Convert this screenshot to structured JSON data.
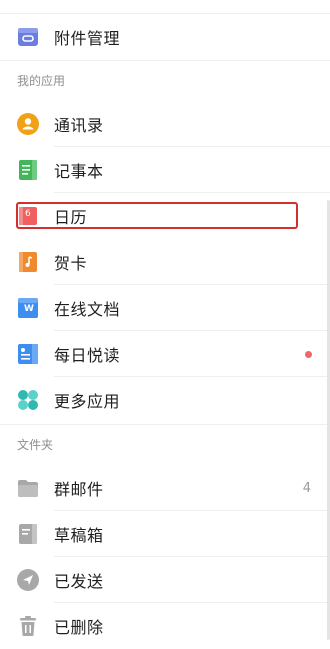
{
  "items": {
    "attachments": {
      "label": "附件管理"
    },
    "contacts": {
      "label": "通讯录"
    },
    "notes": {
      "label": "记事本"
    },
    "calendar": {
      "label": "日历",
      "icon_text": "6"
    },
    "cards": {
      "label": "贺卡"
    },
    "online_docs": {
      "label": "在线文档",
      "icon_text": "W"
    },
    "daily_read": {
      "label": "每日悦读"
    },
    "more_apps": {
      "label": "更多应用"
    },
    "group_mail": {
      "label": "群邮件",
      "count": "4"
    },
    "drafts": {
      "label": "草稿箱"
    },
    "sent": {
      "label": "已发送"
    },
    "deleted": {
      "label": "已删除"
    }
  },
  "sections": {
    "my_apps": "我的应用",
    "folders": "文件夹"
  },
  "colors": {
    "attachment_icon": "#6b7de0",
    "contacts_icon": "#f3a114",
    "notes_icon": "#43b65a",
    "calendar_icon": "#f06060",
    "cards_icon": "#f08a2e",
    "docs_icon": "#3e8ef0",
    "daily_icon": "#3e8ef0",
    "more_icon": "#30b9b0",
    "folder_icon": "#a8a8a8",
    "selection_border": "#d32f2f",
    "unread_dot": "#e86a6a"
  }
}
